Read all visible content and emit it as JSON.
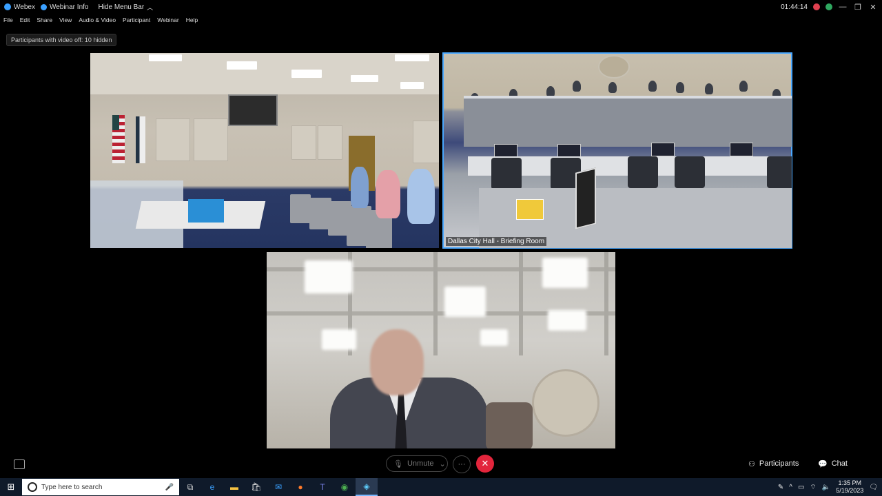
{
  "titlebar": {
    "app_name": "Webex",
    "webinar_info": "Webinar Info",
    "hide_menu_bar": "Hide Menu Bar",
    "timer": "01:44:14"
  },
  "menu": [
    "File",
    "Edit",
    "Share",
    "View",
    "Audio & Video",
    "Participant",
    "Webinar",
    "Help"
  ],
  "participants_notice": "Participants with video off: 10 hidden",
  "tiles": {
    "briefing_room_label": "Dallas City Hall - Briefing Room"
  },
  "controls": {
    "unmute_label": "Unmute",
    "participants_label": "Participants",
    "chat_label": "Chat"
  },
  "taskbar": {
    "search_placeholder": "Type here to search",
    "time": "1:35 PM",
    "date": "5/19/2023"
  },
  "colors": {
    "active_outline": "#4aa8ff",
    "leave_button": "#e2253c",
    "recording_indicator": "#e04050"
  }
}
